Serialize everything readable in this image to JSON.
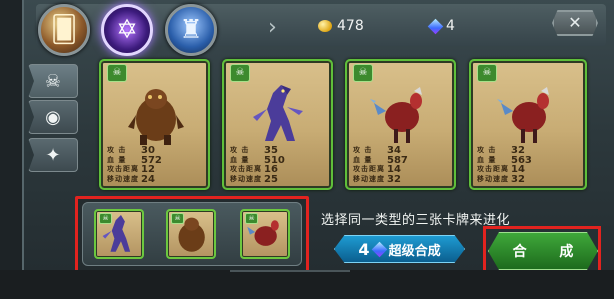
{
  "header": {
    "categories": [
      {
        "icon": "card-deck-icon"
      },
      {
        "icon": "hexagram-icon"
      },
      {
        "icon": "castle-icon"
      }
    ],
    "gold": "478",
    "gems": "4",
    "close_label": "✕"
  },
  "side_tabs": [
    {
      "icon": "beast-face-icon"
    },
    {
      "icon": "eye-icon"
    },
    {
      "icon": "dragon-head-icon"
    }
  ],
  "cards": [
    {
      "creature": "bear",
      "attack": "30",
      "hp": "572",
      "range": "12",
      "speed": "24"
    },
    {
      "creature": "werewolf",
      "attack": "35",
      "hp": "510",
      "range": "16",
      "speed": "25"
    },
    {
      "creature": "red-beast",
      "attack": "34",
      "hp": "587",
      "range": "14",
      "speed": "32"
    },
    {
      "creature": "red-beast",
      "attack": "32",
      "hp": "563",
      "range": "14",
      "speed": "32"
    }
  ],
  "stat_labels": {
    "attack": "攻 击",
    "hp": "血 量",
    "range": "攻击距离",
    "speed": "移动速度"
  },
  "selected": [
    {
      "creature": "werewolf"
    },
    {
      "creature": "bear"
    },
    {
      "creature": "red-beast"
    }
  ],
  "hint_text": "选择同一类型的三张卡牌来进化",
  "super_button": {
    "count": "4",
    "label": "超级合成"
  },
  "compose_button": {
    "label": "合 成"
  }
}
